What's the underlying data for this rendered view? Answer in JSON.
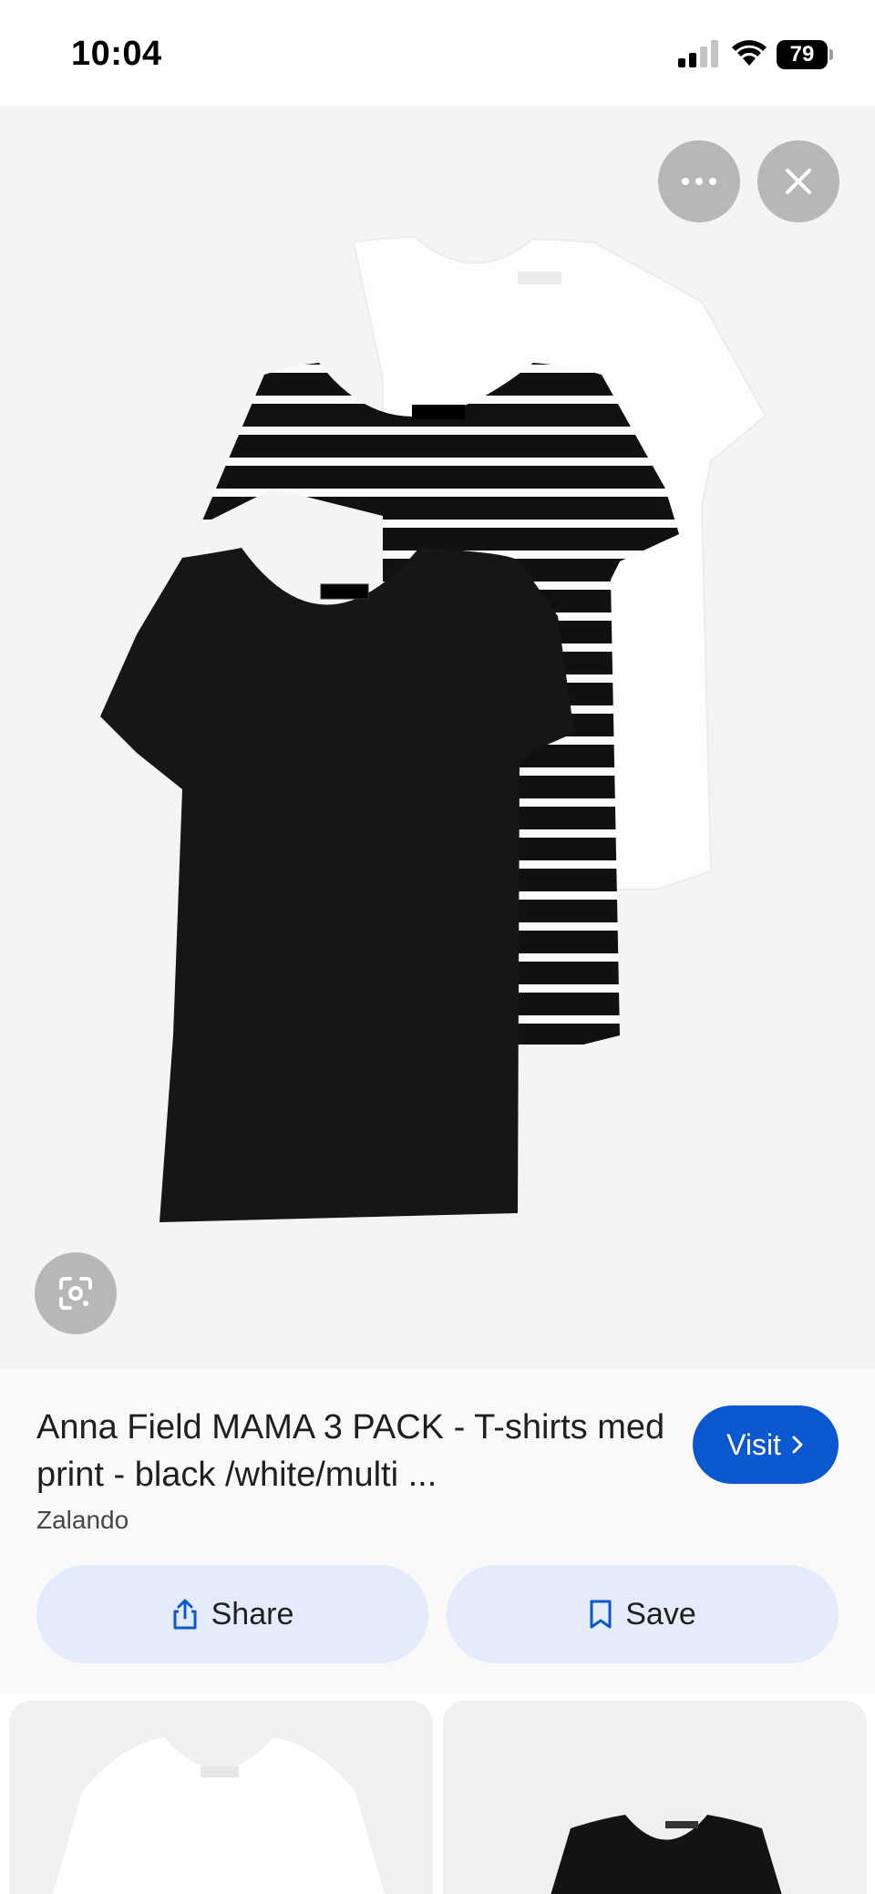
{
  "status_bar": {
    "time": "10:04",
    "battery": "79"
  },
  "viewer": {
    "more_icon": "ellipsis-icon",
    "close_icon": "close-icon",
    "lens_icon": "lens-icon",
    "image_brand_label": "ANNA FIELD"
  },
  "product": {
    "title": "Anna Field MAMA 3 PACK - T-shirts med print - black /white/multi ...",
    "source": "Zalando",
    "visit_label": "Visit",
    "share_label": "Share",
    "save_label": "Save"
  },
  "colors": {
    "accent": "#0b57d0",
    "action_bg": "#e4ecfb"
  }
}
